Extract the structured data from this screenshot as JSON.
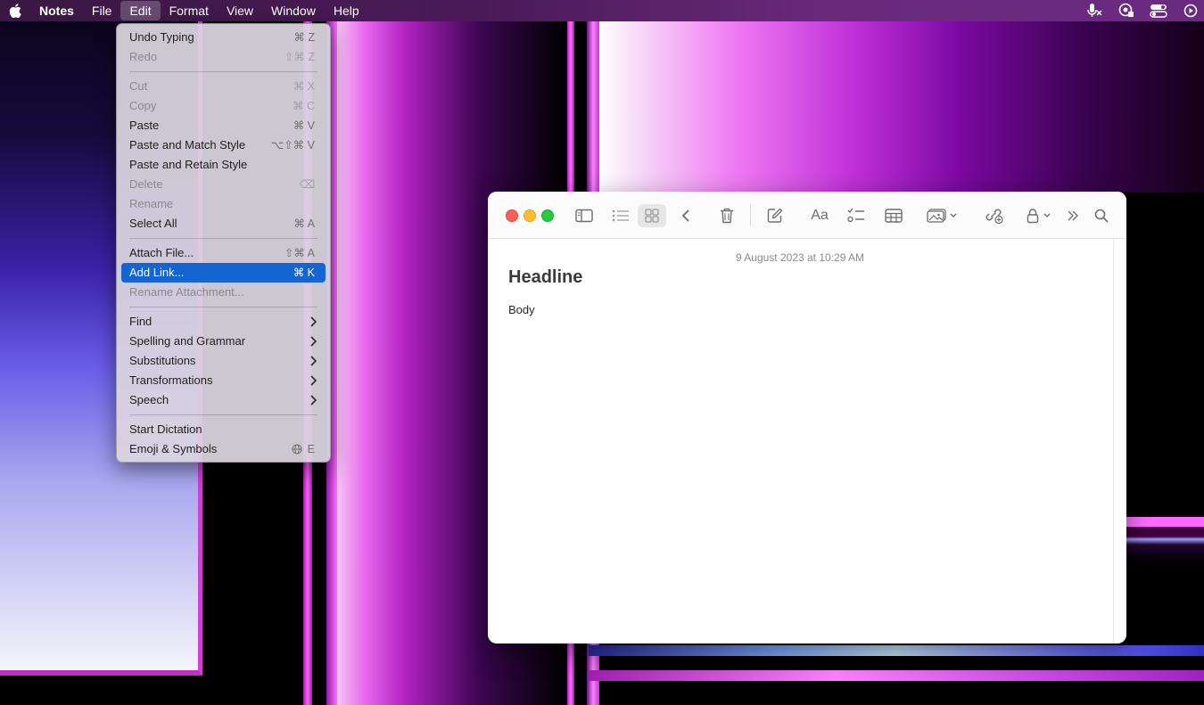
{
  "menubar": {
    "app_name": "Notes",
    "items": [
      "File",
      "Edit",
      "Format",
      "View",
      "Window",
      "Help"
    ],
    "active_item": "Edit",
    "status_icons": [
      "microphone-muted-icon",
      "password-key-icon",
      "control-center-icon",
      "screen-recording-icon"
    ]
  },
  "edit_menu": {
    "items": [
      {
        "label": "Undo Typing",
        "shortcut": "⌘ Z",
        "enabled": true
      },
      {
        "label": "Redo",
        "shortcut": "⇧⌘ Z",
        "enabled": false
      },
      {
        "label": "Cut",
        "shortcut": "⌘ X",
        "enabled": false
      },
      {
        "label": "Copy",
        "shortcut": "⌘ C",
        "enabled": false
      },
      {
        "label": "Paste",
        "shortcut": "⌘ V",
        "enabled": true
      },
      {
        "label": "Paste and Match Style",
        "shortcut": "⌥⇧⌘ V",
        "enabled": true
      },
      {
        "label": "Paste and Retain Style",
        "shortcut": "",
        "enabled": true
      },
      {
        "label": "Delete",
        "shortcut": "⌫",
        "enabled": false
      },
      {
        "label": "Rename",
        "shortcut": "",
        "enabled": false
      },
      {
        "label": "Select All",
        "shortcut": "⌘ A",
        "enabled": true
      },
      {
        "label": "Attach File...",
        "shortcut": "⇧⌘ A",
        "enabled": true
      },
      {
        "label": "Add Link...",
        "shortcut": "⌘ K",
        "enabled": true,
        "selected": true
      },
      {
        "label": "Rename Attachment...",
        "shortcut": "",
        "enabled": false
      },
      {
        "label": "Find",
        "submenu": true,
        "enabled": true
      },
      {
        "label": "Spelling and Grammar",
        "submenu": true,
        "enabled": true
      },
      {
        "label": "Substitutions",
        "submenu": true,
        "enabled": true
      },
      {
        "label": "Transformations",
        "submenu": true,
        "enabled": true
      },
      {
        "label": "Speech",
        "submenu": true,
        "enabled": true
      },
      {
        "label": "Start Dictation",
        "shortcut": "",
        "enabled": true
      },
      {
        "label": "Emoji & Symbols",
        "shortcut": "E",
        "shortcut_icon": "globe-icon",
        "enabled": true
      }
    ],
    "selection_color": "#1464d2"
  },
  "notes_window": {
    "toolbar_icons": [
      "sidebar-toggle-icon",
      "list-view-icon",
      "gallery-view-icon",
      "back-icon",
      "trash-icon",
      "compose-icon",
      "format-text-icon",
      "checklist-icon",
      "table-icon",
      "media-icon",
      "collaborate-icon",
      "lock-icon",
      "more-icon",
      "search-icon"
    ],
    "format_label": "Aa",
    "note": {
      "date": "9 August 2023 at 10:29 AM",
      "title": "Headline",
      "body": "Body"
    }
  },
  "colors": {
    "traffic_red": "#fe5f57",
    "traffic_yellow": "#febc2e",
    "traffic_green": "#28c840"
  }
}
